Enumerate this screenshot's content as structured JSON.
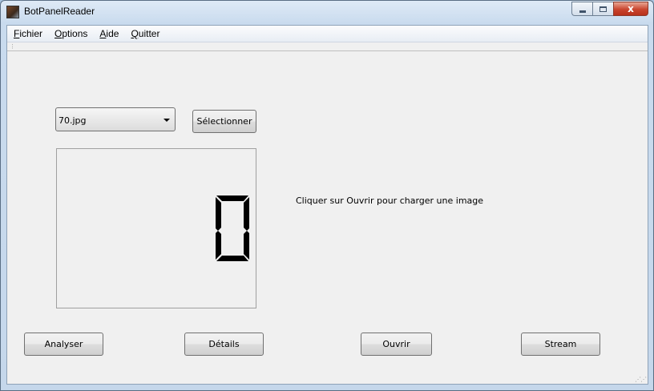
{
  "window": {
    "title": "BotPanelReader",
    "icon": "app-icon"
  },
  "caption_buttons": {
    "minimize": "minimize-icon",
    "maximize": "maximize-icon",
    "close": "x"
  },
  "menu": [
    {
      "accel": "F",
      "rest": "ichier"
    },
    {
      "accel": "O",
      "rest": "ptions"
    },
    {
      "accel": "A",
      "rest": "ide"
    },
    {
      "accel": "Q",
      "rest": "uitter"
    }
  ],
  "file_combo": {
    "value": "70.jpg"
  },
  "buttons": {
    "select": "Sélectionner",
    "analyze": "Analyser",
    "details": "Détails",
    "open": "Ouvrir",
    "stream": "Stream"
  },
  "preview": {
    "digit": "0"
  },
  "hint": "Cliquer sur Ouvrir pour charger une image"
}
